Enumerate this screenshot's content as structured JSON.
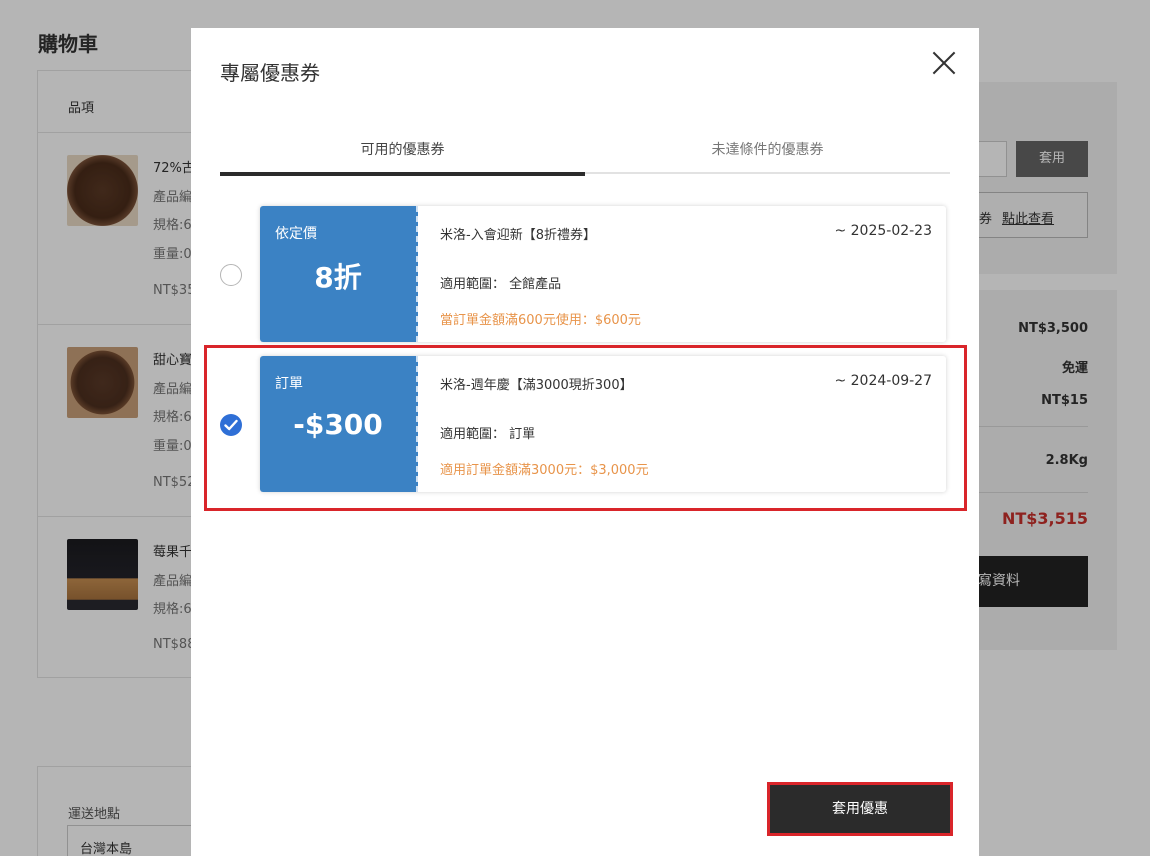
{
  "background": {
    "page_title": "購物車",
    "cart_header": "品項",
    "items": [
      {
        "name": "72%古",
        "line1": "產品編",
        "line2": "規格:6",
        "line3": "重量:0",
        "price": "NT$35"
      },
      {
        "name": "甜心寶",
        "line1": "產品編",
        "line2": "規格:6",
        "line3": "重量:0",
        "price": "NT$52"
      },
      {
        "name": "莓果千",
        "line1": "產品編",
        "line2": "規格:6",
        "price": "NT$88"
      }
    ],
    "shipping_label": "運送地點",
    "shipping_value": "台灣本島",
    "apply_label": "套用",
    "view_text": "券",
    "view_link": "點此查看",
    "summary": {
      "subtotal": "NT$3,500",
      "shipping": "免運",
      "fee": "NT$15",
      "weight": "2.8Kg",
      "total": "NT$3,515",
      "fill_button": "寫資料"
    }
  },
  "modal": {
    "title": "專屬優惠券",
    "tabs": [
      {
        "label": "可用的優惠券",
        "active": true
      },
      {
        "label": "未達條件的優惠券",
        "active": false
      }
    ],
    "coupons": [
      {
        "type": "依定價",
        "value": "8折",
        "name": "米洛-入會迎新【8折禮券】",
        "date": "~ 2025-02-23",
        "scope": "適用範圍： 全館產品",
        "condition": "當訂單金額滿600元使用：$600元",
        "selected": false
      },
      {
        "type": "訂單",
        "value": "-$300",
        "name": "米洛-週年慶【滿3000現折300】",
        "date": "~ 2024-09-27",
        "scope": "適用範圍： 訂單",
        "condition": "適用訂單金額滿3000元：$3,000元",
        "selected": true
      }
    ],
    "apply_button": "套用優惠"
  },
  "colors": {
    "coupon_blue": "#3b82c4",
    "condition_orange": "#e8944a",
    "highlight_red": "#d9252a",
    "total_red": "#c9302c",
    "check_blue": "#2f6fd6"
  },
  "icons": {
    "close": "close-icon",
    "radio_checked": "check-icon"
  }
}
